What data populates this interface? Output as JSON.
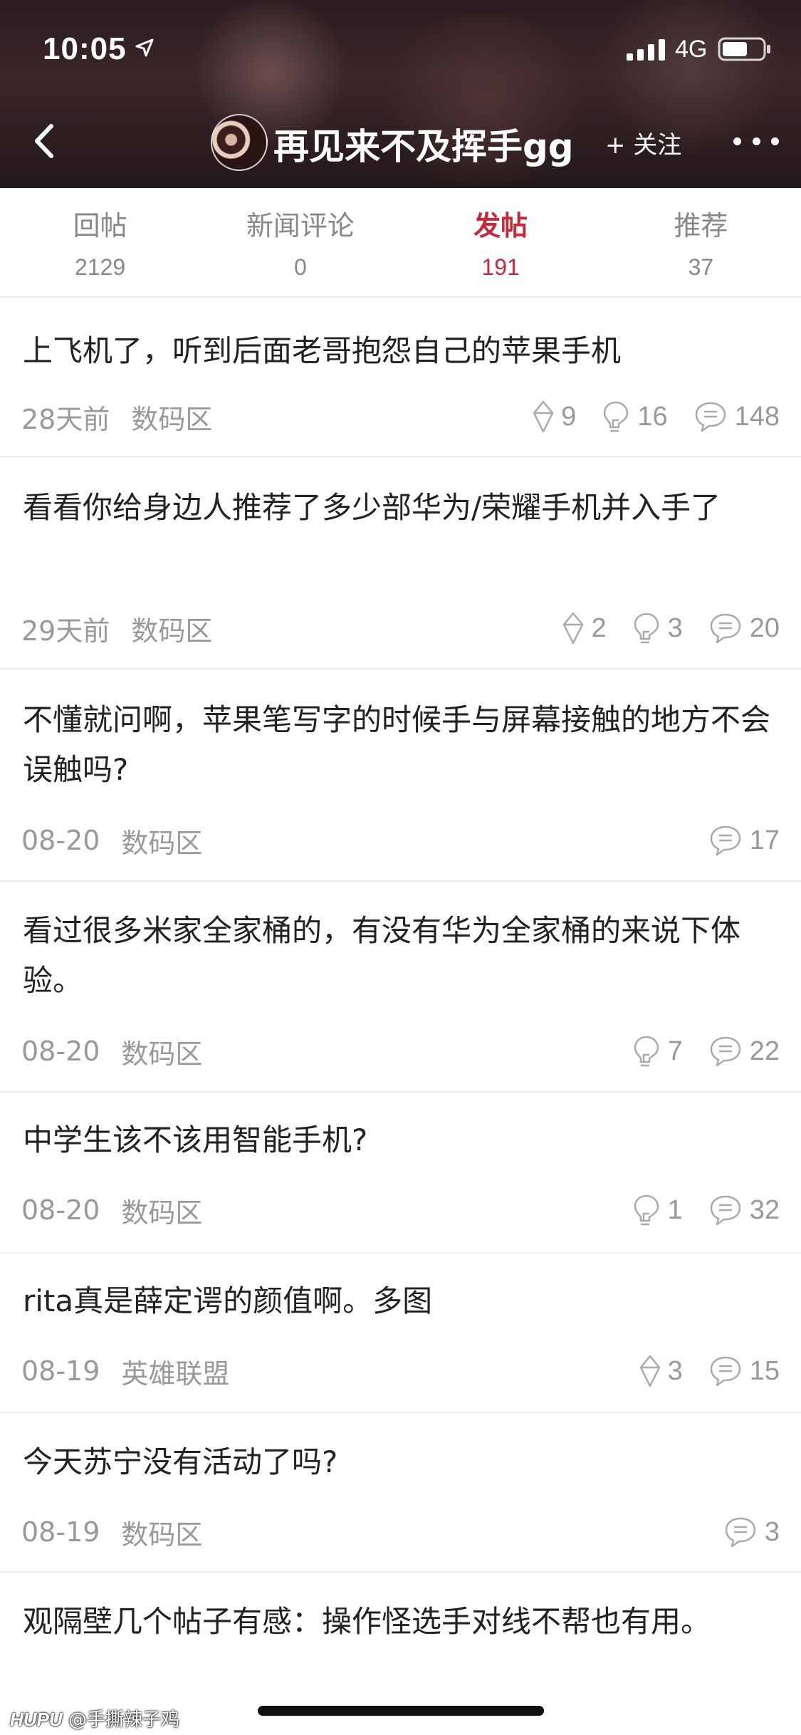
{
  "status_bar": {
    "time": "10:05",
    "network": "4G"
  },
  "header": {
    "user_name": "再见来不及挥手gg",
    "follow_label": "+ 关注"
  },
  "tabs": [
    {
      "label": "回帖",
      "count": "2129",
      "active": false
    },
    {
      "label": "新闻评论",
      "count": "0",
      "active": false
    },
    {
      "label": "发帖",
      "count": "191",
      "active": true
    },
    {
      "label": "推荐",
      "count": "37",
      "active": false
    }
  ],
  "posts": [
    {
      "title": "上飞机了，听到后面老哥抱怨自己的苹果手机",
      "time": "28天前",
      "board": "数码区",
      "likes": "9",
      "lights": "16",
      "replies": "148"
    },
    {
      "title": "看看你给身边人推荐了多少部华为/荣耀手机并入手了",
      "time": "29天前",
      "board": "数码区",
      "likes": "2",
      "lights": "3",
      "replies": "20"
    },
    {
      "title": "不懂就问啊，苹果笔写字的时候手与屏幕接触的地方不会误触吗?",
      "time": "08-20",
      "board": "数码区",
      "likes": null,
      "lights": null,
      "replies": "17"
    },
    {
      "title": "看过很多米家全家桶的，有没有华为全家桶的来说下体验。",
      "time": "08-20",
      "board": "数码区",
      "likes": null,
      "lights": "7",
      "replies": "22"
    },
    {
      "title": "中学生该不该用智能手机?",
      "time": "08-20",
      "board": "数码区",
      "likes": null,
      "lights": "1",
      "replies": "32"
    },
    {
      "title": "rita真是薛定谔的颜值啊。多图",
      "time": "08-19",
      "board": "英雄联盟",
      "likes": "3",
      "lights": null,
      "replies": "15"
    },
    {
      "title": "今天苏宁没有活动了吗?",
      "time": "08-19",
      "board": "数码区",
      "likes": null,
      "lights": null,
      "replies": "3"
    },
    {
      "title": "观隔壁几个帖子有感：操作怪选手对线不帮也有用。",
      "time": "",
      "board": "",
      "likes": null,
      "lights": null,
      "replies": null
    }
  ],
  "watermark": {
    "brand": "HUPU",
    "handle": "@手撕辣子鸡"
  },
  "colors": {
    "accent": "#c6283a",
    "muted": "#999999",
    "divider": "#ececec"
  },
  "icons": {
    "back": "chevron-left-icon",
    "more": "more-dots-icon",
    "like": "recommend-diamond-icon",
    "light": "lightbulb-icon",
    "reply": "comment-bubble-icon"
  }
}
